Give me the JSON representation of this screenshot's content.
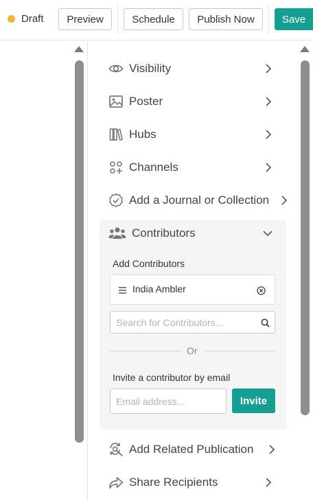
{
  "toolbar": {
    "status": "Draft",
    "preview": "Preview",
    "schedule": "Schedule",
    "publish_now": "Publish Now",
    "save": "Save"
  },
  "menu": {
    "visibility": "Visibility",
    "poster": "Poster",
    "hubs": "Hubs",
    "channels": "Channels",
    "journal": "Add a Journal or Collection",
    "contributors": "Contributors",
    "related": "Add Related Publication",
    "share": "Share Recipients"
  },
  "contributors": {
    "add_heading": "Add Contributors",
    "chip_name": "India Ambler",
    "search_placeholder": "Search for Contributors...",
    "or": "Or",
    "invite_heading": "Invite a contributor by email",
    "email_placeholder": "Email address...",
    "invite_button": "Invite"
  },
  "colors": {
    "accent": "#159e91",
    "draft_dot": "#e9b53e"
  }
}
